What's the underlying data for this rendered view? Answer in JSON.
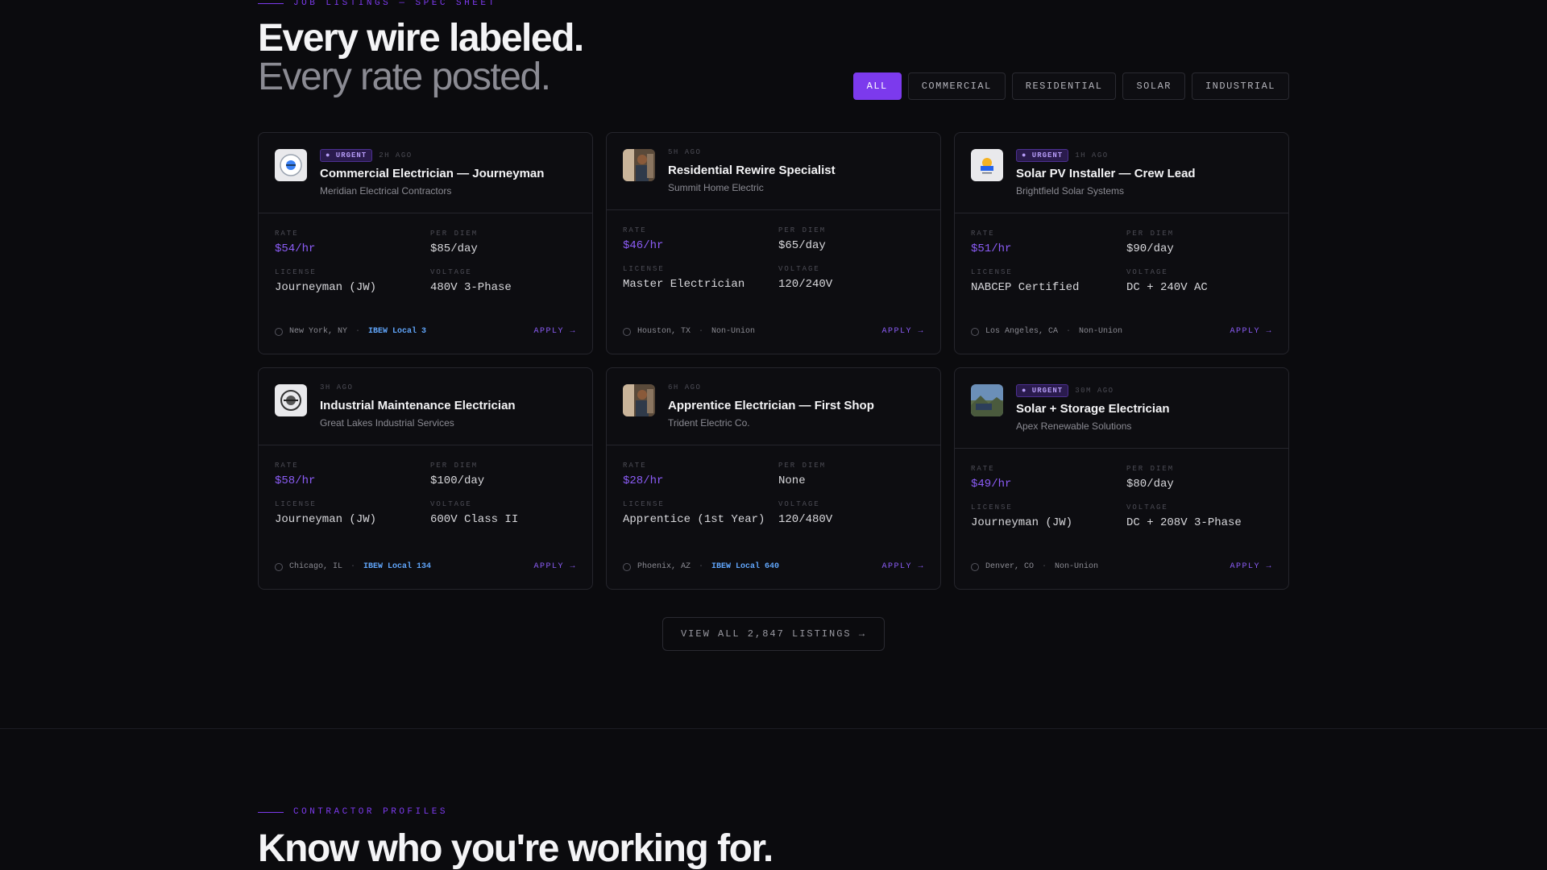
{
  "section1": {
    "eyebrow": "JOB LISTINGS — SPEC SHEET",
    "title_line1": "Every wire labeled.",
    "title_line2": "Every rate posted."
  },
  "filters": [
    {
      "label": "ALL",
      "active": true
    },
    {
      "label": "COMMERCIAL",
      "active": false
    },
    {
      "label": "RESIDENTIAL",
      "active": false
    },
    {
      "label": "SOLAR",
      "active": false
    },
    {
      "label": "INDUSTRIAL",
      "active": false
    }
  ],
  "spec_labels": {
    "rate": "RATE",
    "per_diem": "PER DIEM",
    "license": "LICENSE",
    "voltage": "VOLTAGE"
  },
  "urgent_label": "● URGENT",
  "apply_label": "APPLY →",
  "jobs": [
    {
      "urgent": true,
      "ago": "2H AGO",
      "title": "Commercial Electrician — Journeyman",
      "company": "Meridian Electrical Contractors",
      "rate": "$54/hr",
      "per_diem": "$85/day",
      "license": "Journeyman (JW)",
      "voltage": "480V 3-Phase",
      "location": "New York, NY",
      "union": "IBEW Local 3",
      "logo": "company-logo-icon"
    },
    {
      "urgent": false,
      "ago": "5H AGO",
      "title": "Residential Rewire Specialist",
      "company": "Summit Home Electric",
      "rate": "$46/hr",
      "per_diem": "$65/day",
      "license": "Master Electrician",
      "voltage": "120/240V",
      "location": "Houston, TX",
      "union": "Non-Union",
      "logo": "worker-photo-icon"
    },
    {
      "urgent": true,
      "ago": "1H AGO",
      "title": "Solar PV Installer — Crew Lead",
      "company": "Brightfield Solar Systems",
      "rate": "$51/hr",
      "per_diem": "$90/day",
      "license": "NABCEP Certified",
      "voltage": "DC + 240V AC",
      "location": "Los Angeles, CA",
      "union": "Non-Union",
      "logo": "solar-logo-icon"
    },
    {
      "urgent": false,
      "ago": "3H AGO",
      "title": "Industrial Maintenance Electrician",
      "company": "Great Lakes Industrial Services",
      "rate": "$58/hr",
      "per_diem": "$100/day",
      "license": "Journeyman (JW)",
      "voltage": "600V Class II",
      "location": "Chicago, IL",
      "union": "IBEW Local 134",
      "logo": "industrial-logo-icon"
    },
    {
      "urgent": false,
      "ago": "6H AGO",
      "title": "Apprentice Electrician — First Shop",
      "company": "Trident Electric Co.",
      "rate": "$28/hr",
      "per_diem": "None",
      "license": "Apprentice (1st Year)",
      "voltage": "120/480V",
      "location": "Phoenix, AZ",
      "union": "IBEW Local 640",
      "logo": "worker-photo-icon"
    },
    {
      "urgent": true,
      "ago": "30M AGO",
      "title": "Solar + Storage Electrician",
      "company": "Apex Renewable Solutions",
      "rate": "$49/hr",
      "per_diem": "$80/day",
      "license": "Journeyman (JW)",
      "voltage": "DC + 208V 3-Phase",
      "location": "Denver, CO",
      "union": "Non-Union",
      "logo": "landscape-photo-icon"
    }
  ],
  "view_all": "VIEW ALL 2,847 LISTINGS →",
  "section2": {
    "eyebrow": "CONTRACTOR PROFILES",
    "title": "Know who you're working for."
  },
  "colors": {
    "accent": "#7c3aed",
    "accent_text": "#8b5cf6",
    "ibew": "#60a5fa",
    "background": "#0b0b0e"
  }
}
